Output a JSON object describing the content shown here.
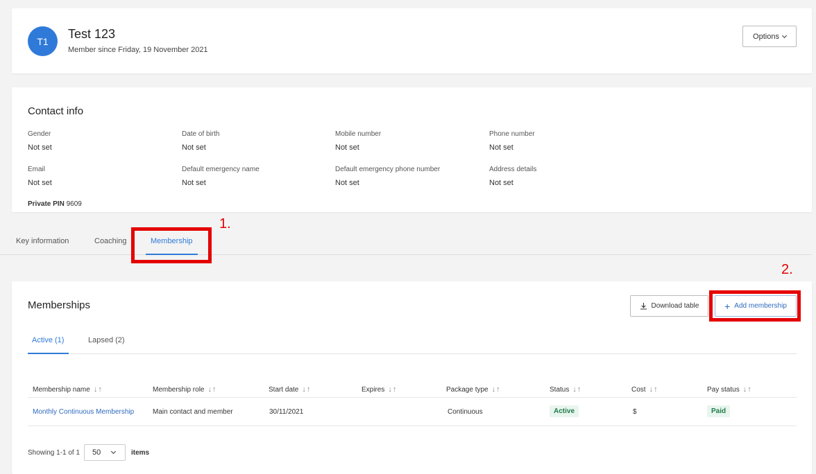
{
  "header": {
    "avatar_initials": "T1",
    "name": "Test 123",
    "member_since": "Member since Friday, 19 November 2021",
    "options_label": "Options"
  },
  "contact": {
    "title": "Contact info",
    "fields": [
      {
        "label": "Gender",
        "value": "Not set"
      },
      {
        "label": "Date of birth",
        "value": "Not set"
      },
      {
        "label": "Mobile number",
        "value": "Not set"
      },
      {
        "label": "Phone number",
        "value": "Not set"
      },
      {
        "label": "Email",
        "value": "Not set"
      },
      {
        "label": "Default emergency name",
        "value": "Not set"
      },
      {
        "label": "Default emergency phone number",
        "value": "Not set"
      },
      {
        "label": "Address details",
        "value": "Not set"
      }
    ],
    "pin_label": "Private PIN",
    "pin_value": "9609"
  },
  "tabs": [
    {
      "label": "Key information"
    },
    {
      "label": "Coaching"
    },
    {
      "label": "Membership",
      "active": true
    }
  ],
  "annotations": {
    "one": "1.",
    "two": "2."
  },
  "memberships": {
    "title": "Memberships",
    "download_label": "Download table",
    "add_label": "Add membership",
    "subtabs": [
      {
        "label": "Active (1)",
        "active": true
      },
      {
        "label": "Lapsed (2)"
      }
    ],
    "columns": [
      "Membership name",
      "Membership role",
      "Start date",
      "Expires",
      "Package type",
      "Status",
      "Cost",
      "Pay status"
    ],
    "rows": [
      {
        "name": "Monthly Continuous Membership",
        "role": "Main contact and member",
        "start": "30/11/2021",
        "expires": "",
        "package": "Continuous",
        "status": "Active",
        "cost": "$",
        "pay_status": "Paid"
      }
    ],
    "showing": "Showing 1-1 of 1",
    "page_size": "50",
    "items_label": "items"
  },
  "colors": {
    "accent": "#2f7ad9",
    "annotation": "#e50000",
    "paid": "#1f7a4a"
  }
}
